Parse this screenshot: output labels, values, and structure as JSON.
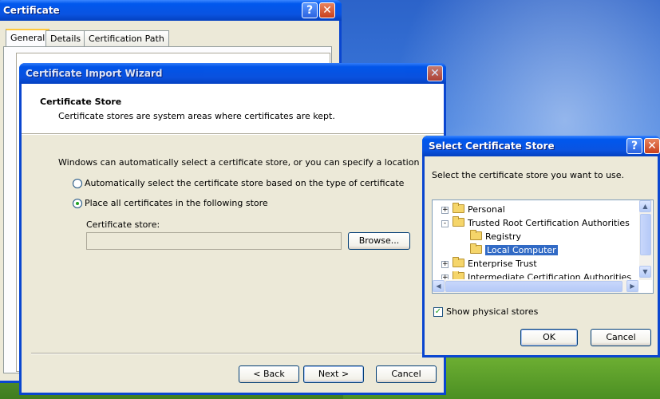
{
  "desktop": {},
  "certificate_window": {
    "title": "Certificate",
    "tabs": [
      "General",
      "Details",
      "Certification Path"
    ]
  },
  "wizard": {
    "title": "Certificate Import Wizard",
    "header_title": "Certificate Store",
    "header_desc": "Certificate stores are system areas where certificates are kept.",
    "intro": "Windows can automatically select a certificate store, or you can specify a location for",
    "radio_auto": "Automatically select the certificate store based on the type of certificate",
    "radio_place": "Place all certificates in the following store",
    "store_label": "Certificate store:",
    "store_value": "",
    "browse": "Browse...",
    "back": "< Back",
    "next": "Next >",
    "cancel": "Cancel"
  },
  "select_store": {
    "title": "Select Certificate Store",
    "prompt": "Select the certificate store you want to use.",
    "tree": [
      {
        "label": "Personal",
        "expander": "+"
      },
      {
        "label": "Trusted Root Certification Authorities",
        "expander": "-"
      },
      {
        "label": "Registry",
        "expander": ""
      },
      {
        "label": "Local Computer",
        "expander": ""
      },
      {
        "label": "Enterprise Trust",
        "expander": "+"
      },
      {
        "label": "Intermediate Certification Authorities",
        "expander": "+"
      }
    ],
    "show_physical": "Show physical stores",
    "ok": "OK",
    "cancel": "Cancel"
  },
  "icons": {
    "help": "?",
    "close": "✕",
    "up": "▲",
    "down": "▼",
    "left": "◀",
    "right": "▶",
    "check": "✓"
  }
}
